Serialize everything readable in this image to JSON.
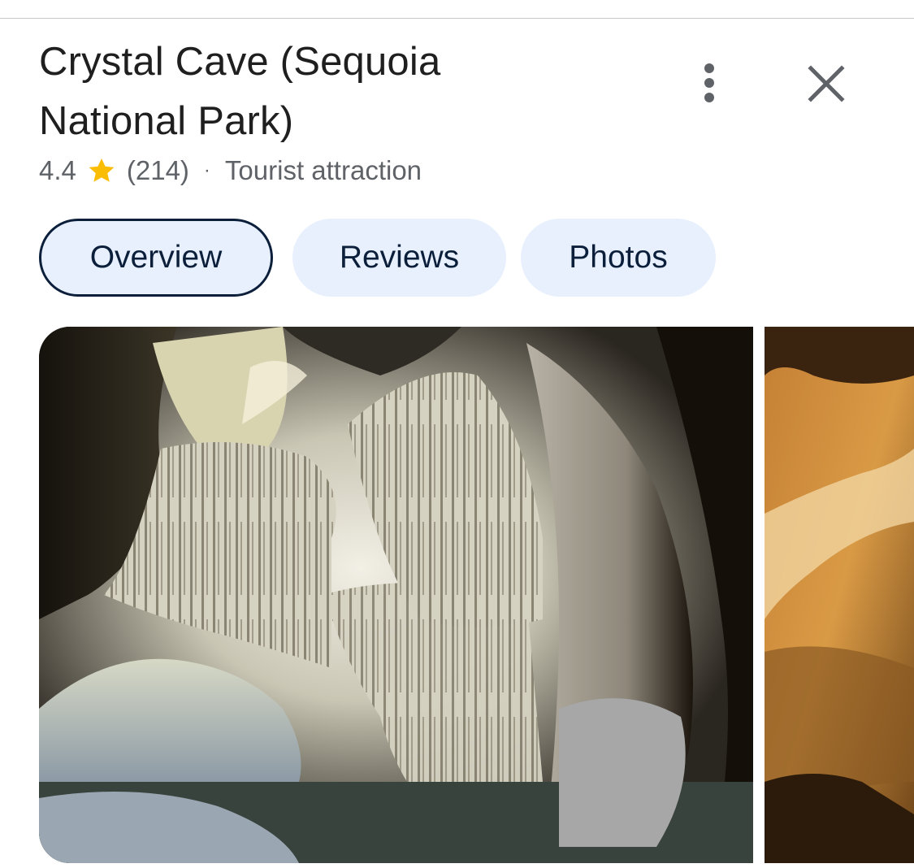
{
  "place": {
    "title": "Crystal Cave (Sequoia National Park)",
    "rating": "4.4",
    "review_count": "(214)",
    "separator": "·",
    "category": "Tourist attraction"
  },
  "tabs": [
    {
      "label": "Overview",
      "active": true
    },
    {
      "label": "Reviews",
      "active": false
    },
    {
      "label": "Photos",
      "active": false
    }
  ],
  "icons": {
    "more": "more-vert-icon",
    "close": "close-icon",
    "star": "star-icon"
  },
  "colors": {
    "text_primary": "#1f1f1f",
    "text_secondary": "#5f6368",
    "star": "#fbbc04",
    "chip_bg": "#e8f0fe",
    "chip_text": "#0b1f3a"
  }
}
